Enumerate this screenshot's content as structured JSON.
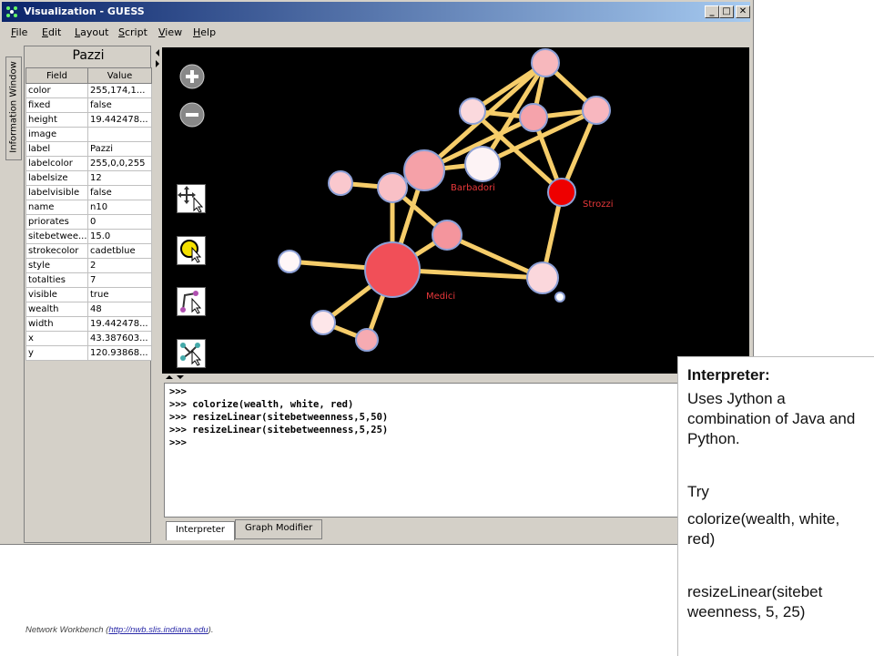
{
  "window": {
    "title": "Visualization - GUESS",
    "min": "_",
    "max": "□",
    "close": "✕"
  },
  "menu": [
    "File",
    "Edit",
    "Layout",
    "Script",
    "View",
    "Help"
  ],
  "info_tab_label": "Information Window",
  "info_panel": {
    "title": "Pazzi",
    "columns": [
      "Field",
      "Value"
    ],
    "rows": [
      [
        "color",
        "255,174,1..."
      ],
      [
        "fixed",
        "false"
      ],
      [
        "height",
        "19.442478..."
      ],
      [
        "image",
        ""
      ],
      [
        "label",
        "Pazzi"
      ],
      [
        "labelcolor",
        "255,0,0,255"
      ],
      [
        "labelsize",
        "12"
      ],
      [
        "labelvisible",
        "false"
      ],
      [
        "name",
        "n10"
      ],
      [
        "priorates",
        "0"
      ],
      [
        "sitebetwee...",
        "15.0"
      ],
      [
        "strokecolor",
        "cadetblue"
      ],
      [
        "style",
        "2"
      ],
      [
        "totalties",
        "7"
      ],
      [
        "visible",
        "true"
      ],
      [
        "wealth",
        "48"
      ],
      [
        "width",
        "19.442478..."
      ],
      [
        "x",
        "43.387603..."
      ],
      [
        "y",
        "120.93868..."
      ]
    ]
  },
  "graph": {
    "edge_color": "#f6cd6a",
    "node_stroke": "#8da0d6",
    "label_color": "#e8383a",
    "labels": {
      "barbadori": "Barbadori",
      "strozzi": "Strozzi",
      "medici": "Medici"
    }
  },
  "interpreter": {
    "lines": [
      ">>>",
      ">>> colorize(wealth, white, red)",
      ">>> resizeLinear(sitebetweenness,5,50)",
      ">>> resizeLinear(sitebetweenness,5,25)",
      ">>>"
    ]
  },
  "tabs": [
    "Interpreter",
    "Graph Modifier"
  ],
  "callout": {
    "header": "Interpreter:",
    "desc": "Uses Jython a combination of Java and Python.",
    "try": "Try",
    "code1": "colorize(wealth, white, red)",
    "code2": "resizeLinear(sitebet weenness, 5, 25)"
  },
  "footer": {
    "text": "Network Workbench (",
    "link": "http://nwb.slis.indiana.edu",
    "end": ")."
  }
}
